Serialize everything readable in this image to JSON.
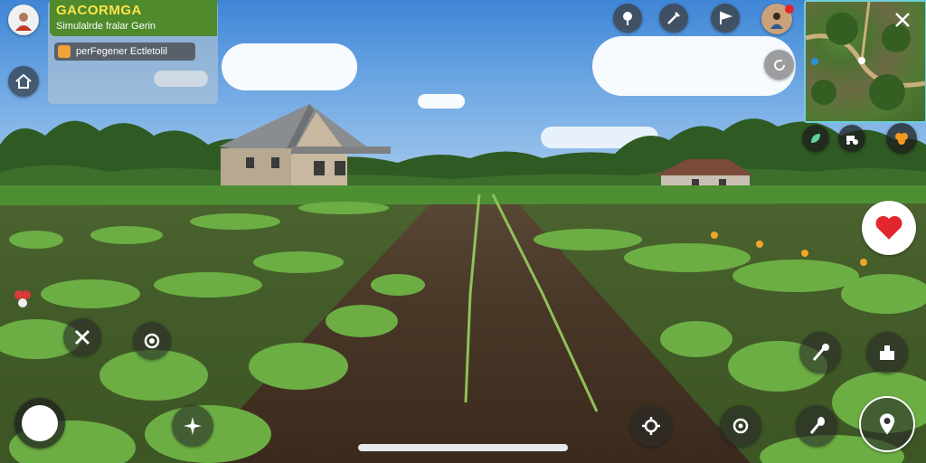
{
  "hud": {
    "title": "GACORMGA",
    "subtitle": "Simulalrde fralar Gerin",
    "quest_label": "perFegener Ectletolil"
  },
  "icons": {
    "avatar": "player-avatar",
    "home": "house-icon",
    "top": [
      "map-pin-icon",
      "tool-icon",
      "flag-icon"
    ],
    "profile": "player-profile-icon",
    "minimap_close": "close-icon",
    "minimap_refresh": "refresh-icon",
    "minimap_row": [
      "seed-icon",
      "tractor-icon",
      "harvest-icon"
    ],
    "favorite": "heart-icon",
    "left_controls": [
      "cancel-icon",
      "target-icon",
      "sparkle-icon",
      "joystick-button"
    ],
    "bottom_controls": [
      "settings-icon",
      "gear-icon"
    ],
    "right_controls": [
      "hoe-icon",
      "inventory-icon",
      "shovel-icon",
      "location-icon"
    ]
  },
  "colors": {
    "title": "#ffe44a",
    "title_bar": "#4f8a2c",
    "minimap_border": "#6fcfd8",
    "heart": "#e2262c"
  }
}
